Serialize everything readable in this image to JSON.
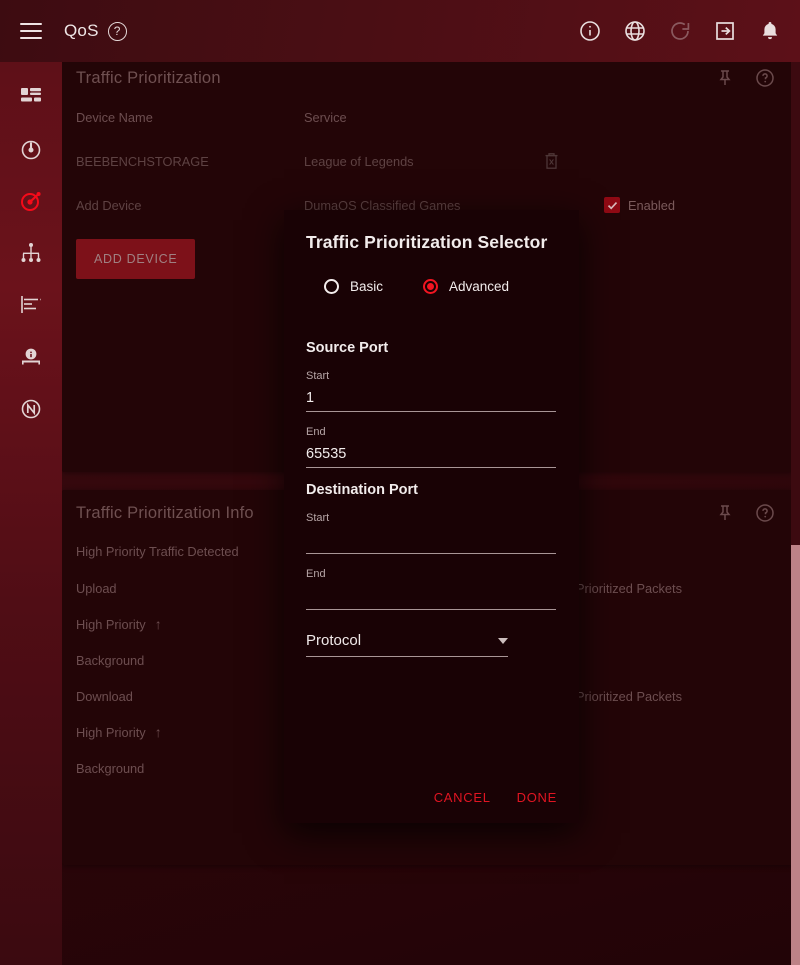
{
  "topbar": {
    "app_title": "QoS",
    "menu_icon": "hamburger-icon",
    "help_icon": "help-circle-icon",
    "icons": [
      {
        "name": "info-icon",
        "label": "Info"
      },
      {
        "name": "globe-icon",
        "label": "Language"
      },
      {
        "name": "refresh-icon",
        "label": "Reload"
      },
      {
        "name": "logout-icon",
        "label": "Logout"
      },
      {
        "name": "bell-icon",
        "label": "Notifications"
      }
    ]
  },
  "sidebar": {
    "items": [
      {
        "name": "dashboard-icon",
        "label": "Dashboard"
      },
      {
        "name": "speedometer-icon",
        "label": "Speed Test"
      },
      {
        "name": "qos-target-icon",
        "label": "QoS",
        "active": true
      },
      {
        "name": "network-map-icon",
        "label": "Network Map"
      },
      {
        "name": "traffic-log-icon",
        "label": "Traffic Log"
      },
      {
        "name": "device-info-icon",
        "label": "Device Manager"
      },
      {
        "name": "netduma-icon",
        "label": "NetDuma"
      }
    ]
  },
  "cards": {
    "traffic_prioritization": {
      "title": "Traffic Prioritization",
      "pin_icon": "pin-icon",
      "help_icon": "help-circle-icon",
      "columns": [
        "Device Name",
        "Service"
      ],
      "rows": [
        {
          "device": "BEEBENCHSTORAGE",
          "service": "League of Legends",
          "delete_icon": "trash-icon",
          "enabled": false,
          "enabled_label": ""
        },
        {
          "device": "Add Device",
          "service": "DumaOS Classified Games",
          "delete_icon": "",
          "enabled": true,
          "enabled_label": "Enabled"
        }
      ],
      "add_device_label": "ADD DEVICE"
    },
    "traffic_prioritization_info": {
      "title": "Traffic Prioritization Info",
      "pin_icon": "pin-icon",
      "help_icon": "help-circle-icon",
      "subtitle": "High Priority Traffic Detected",
      "sections": [
        {
          "heading": "Upload",
          "packets_label": "Prioritized Packets",
          "rows": [
            {
              "label": "High Priority",
              "arrow": "↑"
            },
            {
              "label": "Background",
              "arrow": ""
            }
          ]
        },
        {
          "heading": "Download",
          "packets_label": "Prioritized Packets",
          "rows": [
            {
              "label": "High Priority",
              "arrow": "↑"
            },
            {
              "label": "Background",
              "arrow": ""
            }
          ]
        }
      ]
    }
  },
  "modal": {
    "title": "Traffic Prioritization Selector",
    "modes": [
      {
        "label": "Basic",
        "selected": false
      },
      {
        "label": "Advanced",
        "selected": true
      }
    ],
    "source_port": {
      "heading": "Source Port",
      "start": {
        "label": "Start",
        "value": "1",
        "placeholder": ""
      },
      "end": {
        "label": "End",
        "value": "65535",
        "placeholder": ""
      }
    },
    "destination_port": {
      "heading": "Destination Port",
      "start": {
        "label": "Start",
        "value": "",
        "placeholder": ""
      },
      "end": {
        "label": "End",
        "value": "",
        "placeholder": ""
      }
    },
    "protocol": {
      "label": "Protocol",
      "value": "Protocol",
      "caret_icon": "chevron-down-icon"
    },
    "cancel_label": "CANCEL",
    "done_label": "DONE"
  },
  "colors": {
    "accent_red": "#f21521",
    "brand_dark": "#4a0e14",
    "modal_bg": "#190205",
    "card_bg": "#230507",
    "scrollbar_thumb": "#bd8287"
  }
}
